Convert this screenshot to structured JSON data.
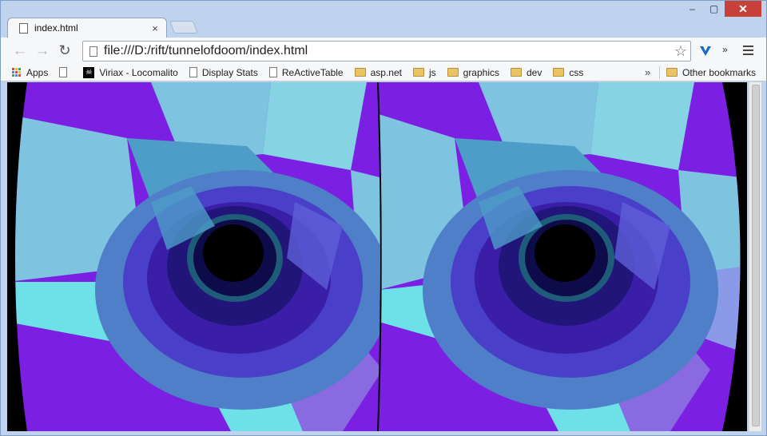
{
  "window": {
    "controls": {
      "minimize": "–",
      "maximize": "▢",
      "close": "✕"
    }
  },
  "tab": {
    "title": "index.html",
    "close": "×"
  },
  "toolbar": {
    "back": "←",
    "forward": "→",
    "reload": "↻",
    "url": "file:///D:/rift/tunnelofdoom/index.html",
    "star": "☆",
    "overflow": "»"
  },
  "bookmarks": {
    "items": [
      {
        "label": "Apps",
        "icon": "apps-grid-icon"
      },
      {
        "label": "",
        "icon": "page-icon"
      },
      {
        "label": "Viriax - Locomalito",
        "icon": "skull-icon"
      },
      {
        "label": "Display Stats",
        "icon": "page-icon"
      },
      {
        "label": "ReActiveTable",
        "icon": "page-icon"
      },
      {
        "label": "asp.net",
        "icon": "folder-icon"
      },
      {
        "label": "js",
        "icon": "folder-icon"
      },
      {
        "label": "graphics",
        "icon": "folder-icon"
      },
      {
        "label": "dev",
        "icon": "folder-icon"
      },
      {
        "label": "css",
        "icon": "folder-icon"
      }
    ],
    "more": "»",
    "other": "Other bookmarks"
  },
  "colors": {
    "purple": "#7b1fe3",
    "light_blue": "#7ec3e0",
    "cyan": "#6ee0e8",
    "mid_blue": "#4e7fc8",
    "deep_blue": "#3a1ea8",
    "navy": "#0e0b4a",
    "teal": "#1e7a7a"
  }
}
